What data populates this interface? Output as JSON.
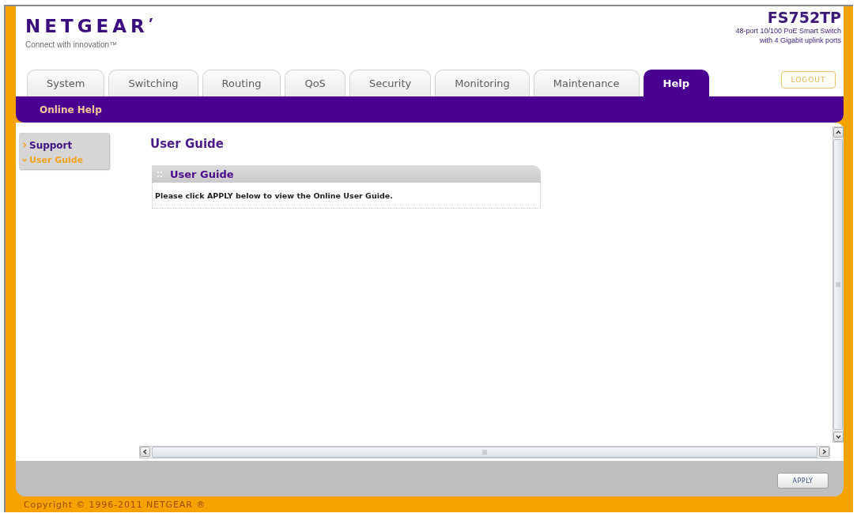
{
  "header": {
    "logo": "NETGEAR",
    "tagline": "Connect with innovation™",
    "model": "FS752TP",
    "description_lines": [
      "48-port 10/100 PoE Smart Switch",
      "with 4 Gigabit uplink ports"
    ]
  },
  "tabs": [
    {
      "label": "System",
      "selected": false
    },
    {
      "label": "Switching",
      "selected": false
    },
    {
      "label": "Routing",
      "selected": false
    },
    {
      "label": "QoS",
      "selected": false
    },
    {
      "label": "Security",
      "selected": false
    },
    {
      "label": "Monitoring",
      "selected": false
    },
    {
      "label": "Maintenance",
      "selected": false
    },
    {
      "label": "Help",
      "selected": true
    }
  ],
  "logout_button": "LOGOUT",
  "subtabs": [
    {
      "label": "Online Help",
      "selected": true
    }
  ],
  "sidebar": {
    "items": [
      {
        "label": "Support",
        "selected": false
      },
      {
        "label": "User Guide",
        "selected": true
      }
    ]
  },
  "page_title": "User Guide",
  "panel": {
    "title": "User Guide",
    "message": "Please click APPLY below to view the Online User Guide."
  },
  "apply_button": "APPLY",
  "footer": "Copyright © 1996-2011 NETGEAR ®"
}
